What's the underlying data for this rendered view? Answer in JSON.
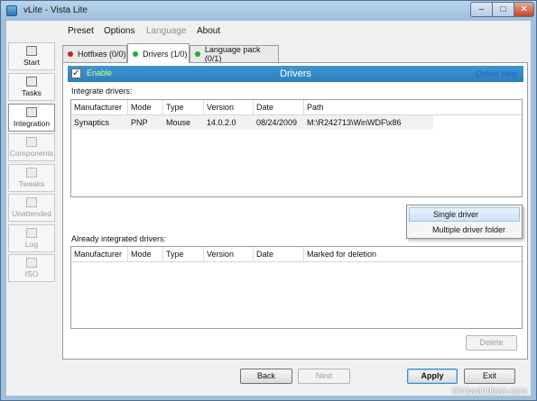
{
  "window": {
    "title": "vLite - Vista Lite",
    "controls": {
      "min": "–",
      "max": "□",
      "close": "✕"
    }
  },
  "menu": {
    "preset": "Preset",
    "options": "Options",
    "language": "Language",
    "about": "About"
  },
  "nav": {
    "start": "Start",
    "tasks": "Tasks",
    "integration": "Integration",
    "components": "Components",
    "tweaks": "Tweaks",
    "unattended": "Unattended",
    "log": "Log",
    "iso": "ISO"
  },
  "tabs": {
    "hotfixes": {
      "label": "Hotfixes (0/0)",
      "dot_color": "#d42020"
    },
    "drivers": {
      "label": "Drivers (1/0)",
      "dot_color": "#2aa82a"
    },
    "language_pack": {
      "label": "Language pack (0/1)",
      "dot_color": "#2aa82a"
    }
  },
  "header": {
    "checkbox_mark": "✓",
    "enable_label": "Enable",
    "title": "Drivers",
    "help_link": "Online Help"
  },
  "integrate": {
    "label": "Integrate drivers:",
    "columns": [
      "Manufacturer",
      "Mode",
      "Type",
      "Version",
      "Date",
      "Path"
    ],
    "rows": [
      {
        "manufacturer": "Synaptics",
        "mode": "PNP",
        "type": "Mouse",
        "version": "14.0.2.0",
        "date": "08/24/2009",
        "path": "M:\\R242713\\WinWDF\\x86"
      }
    ]
  },
  "already": {
    "label": "Already integrated drivers:",
    "columns": [
      "Manufacturer",
      "Mode",
      "Type",
      "Version",
      "Date",
      "Marked for deletion"
    ]
  },
  "context_menu": {
    "single": "Single driver",
    "multiple": "Multiple driver folder"
  },
  "buttons": {
    "delete": "Delete",
    "back": "Back",
    "next": "Next",
    "apply": "Apply",
    "exit": "Exit"
  },
  "watermark": "©intowindows.com",
  "colors": {
    "header_bar": "#2f88c6",
    "help_link": "#2a5bd8",
    "enable_text": "#d8ff8a"
  }
}
